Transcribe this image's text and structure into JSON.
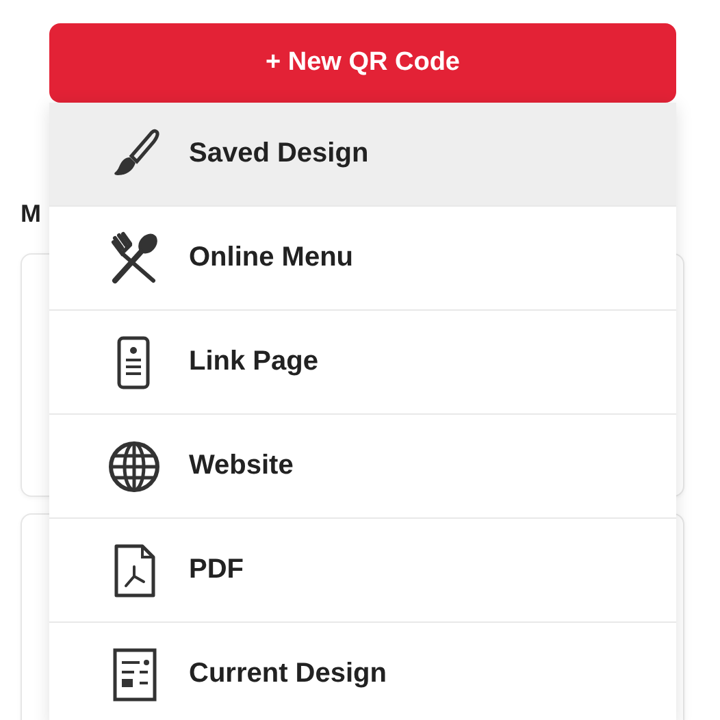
{
  "page": {
    "heading": "M",
    "cards": [
      {
        "kind": "card"
      },
      {
        "kind": "card"
      }
    ]
  },
  "new_button": {
    "label": "+ New QR Code"
  },
  "menu": [
    {
      "label": "Saved Design",
      "kind": "brush",
      "selected": true
    },
    {
      "label": "Online Menu",
      "kind": "cutlery",
      "selected": false
    },
    {
      "label": "Link Page",
      "kind": "phone",
      "selected": false
    },
    {
      "label": "Website",
      "kind": "globe",
      "selected": false
    },
    {
      "label": "PDF",
      "kind": "pdf",
      "selected": false
    },
    {
      "label": "Current Design",
      "kind": "form",
      "selected": false
    }
  ]
}
